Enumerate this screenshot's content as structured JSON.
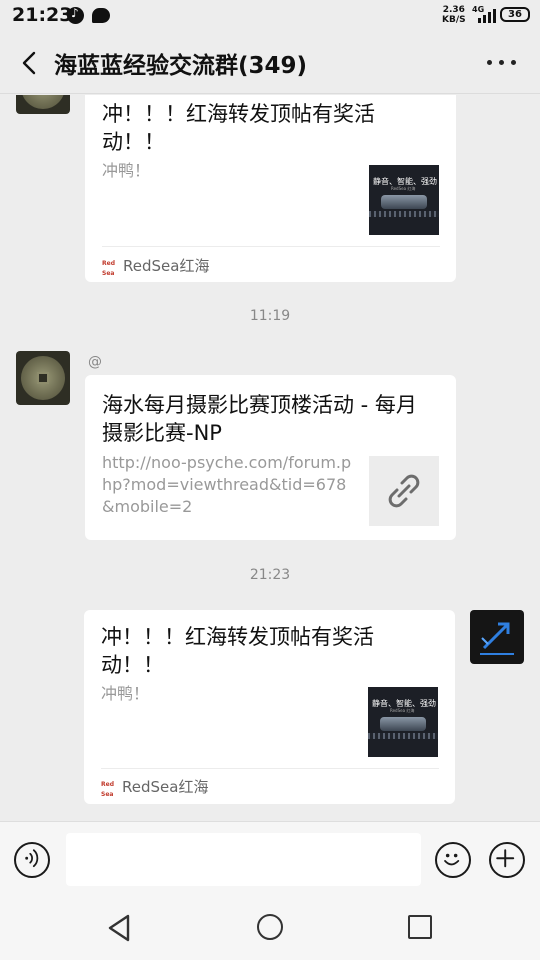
{
  "status_bar": {
    "time": "21:23",
    "net_speed_value": "2.36",
    "net_speed_unit": "KB/S",
    "network_type": "4G",
    "battery": "36"
  },
  "header": {
    "title": "海蓝蓝经验交流群(349)"
  },
  "messages": [
    {
      "card_title": "冲！！！红海转发顶帖有奖活动！！",
      "card_desc": "冲鸭！",
      "thumb_text": "静音、智能、强劲",
      "thumb_subtext": "RedSea 红海",
      "source_logo": "Red Sea",
      "source_name": "RedSea红海"
    },
    {
      "timestamp": "11:19",
      "mention": "@",
      "card_title": "海水每月摄影比赛顶楼活动 - 每月摄影比赛-NP",
      "card_desc": "http://noo-psyche.com/forum.php?mod=viewthread&tid=678&mobile=2"
    },
    {
      "timestamp": "21:23",
      "card_title": "冲！！！红海转发顶帖有奖活动！！",
      "card_desc": "冲鸭！",
      "thumb_text": "静音、智能、强劲",
      "thumb_subtext": "RedSea 红海",
      "source_logo": "Red Sea",
      "source_name": "RedSea红海"
    }
  ],
  "input": {
    "value": ""
  }
}
